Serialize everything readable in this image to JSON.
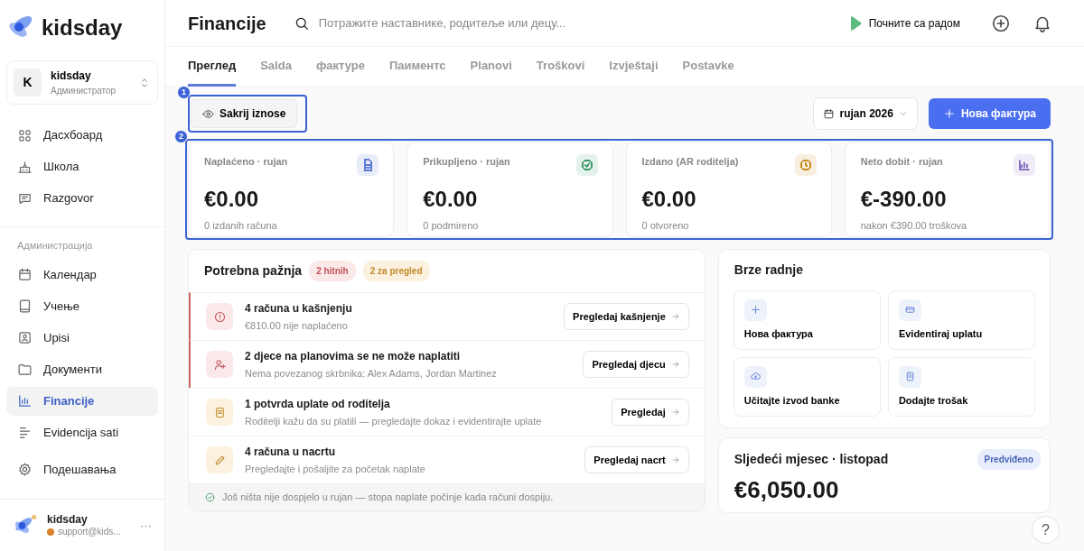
{
  "sidebar": {
    "logo": "kidsday",
    "org": {
      "initial": "K",
      "name": "kidsday",
      "role": "Администратор"
    },
    "items": [
      {
        "label": "Дасхбоард",
        "selected": false
      },
      {
        "label": "Школа",
        "selected": false
      },
      {
        "label": "Razgovor",
        "selected": false
      }
    ],
    "section_label": "Администрација",
    "admin_items": [
      {
        "label": "Календар",
        "selected": false
      },
      {
        "label": "Учење",
        "selected": false
      },
      {
        "label": "Upisi",
        "selected": false
      },
      {
        "label": "Документи",
        "selected": false
      },
      {
        "label": "Financije",
        "selected": true
      },
      {
        "label": "Evidencija sati",
        "selected": false
      }
    ],
    "settings": "Подешавања",
    "user": {
      "name": "kidsday",
      "email": "support@kids...",
      "more": "···"
    }
  },
  "header": {
    "title": "Financije",
    "search": {
      "placeholder": "Потражите наставнике, родитеље или децу..."
    },
    "start": "Почните са радом"
  },
  "tabs": [
    {
      "label": "Преглед",
      "selected": true
    },
    {
      "label": "Salda",
      "selected": false
    },
    {
      "label": "фактуре",
      "selected": false
    },
    {
      "label": "Паиментс",
      "selected": false
    },
    {
      "label": "Planovi",
      "selected": false
    },
    {
      "label": "Troškovi",
      "selected": false
    },
    {
      "label": "Izvještaji",
      "selected": false
    },
    {
      "label": "Postavke",
      "selected": false
    }
  ],
  "annotations": [
    {
      "number": "1"
    },
    {
      "number": "2"
    }
  ],
  "toolbar": {
    "hide": "Sakrij iznose",
    "period": "rujan 2026",
    "new_invoice": "Нова фактура"
  },
  "stats": [
    {
      "label": "Naplaćeno · rujan",
      "value": "€0.00",
      "note": "0 izdanih računa",
      "color": "#5b7bd5"
    },
    {
      "label": "Prikupljeno · rujan",
      "value": "€0.00",
      "note": "0 podmireno",
      "color": "#3f9b6a"
    },
    {
      "label": "Izdano (AR roditelja)",
      "value": "€0.00",
      "note": "0 otvoreno",
      "color": "#c98a1e"
    },
    {
      "label": "Neto dobit · rujan",
      "value": "€-390.00",
      "note": "nakon €390.00 troškova",
      "color": "#8a6fc4"
    }
  ],
  "attention": {
    "title": "Potrebna pažnja",
    "badges": [
      {
        "text": "2 hitnih",
        "kind": "urgent"
      },
      {
        "text": "2 za pregled",
        "kind": "review"
      }
    ],
    "rows": [
      {
        "title": "4 računa u kašnjenju",
        "subtitle": "€810.00 nije naplaćeno",
        "action": "Pregledaj kašnjenje",
        "kind": "urgent"
      },
      {
        "title": "2 djece na planovima se ne može naplatiti",
        "subtitle": "Nema povezanog skrbnika: Alex Adams, Jordan Martinez",
        "action": "Pregledaj djecu",
        "kind": "urgent"
      },
      {
        "title": "1 potvrda uplate od roditelja",
        "subtitle": "Roditelji kažu da su platili — pregledajte dokaz i evidentirajte uplate",
        "action": "Pregledaj",
        "kind": "review"
      },
      {
        "title": "4 računa u nacrtu",
        "subtitle": "Pregledajte i pošaljite za početak naplate",
        "action": "Pregledaj nacrt",
        "kind": "review"
      }
    ],
    "footer": "Još ništa nije dospjelo u rujan — stopa naplate počinje kada računi dospiju."
  },
  "quick_actions": {
    "title": "Brze radnje",
    "items": [
      "Нова фактура",
      "Evidentiraj uplatu",
      "Učitajte izvod banke",
      "Dodajte trošak"
    ]
  },
  "next_month": {
    "title": "Sljedeći mjesec · listopad",
    "badge": "Predviđeno",
    "amount": "€6,050.00"
  },
  "help": "?"
}
